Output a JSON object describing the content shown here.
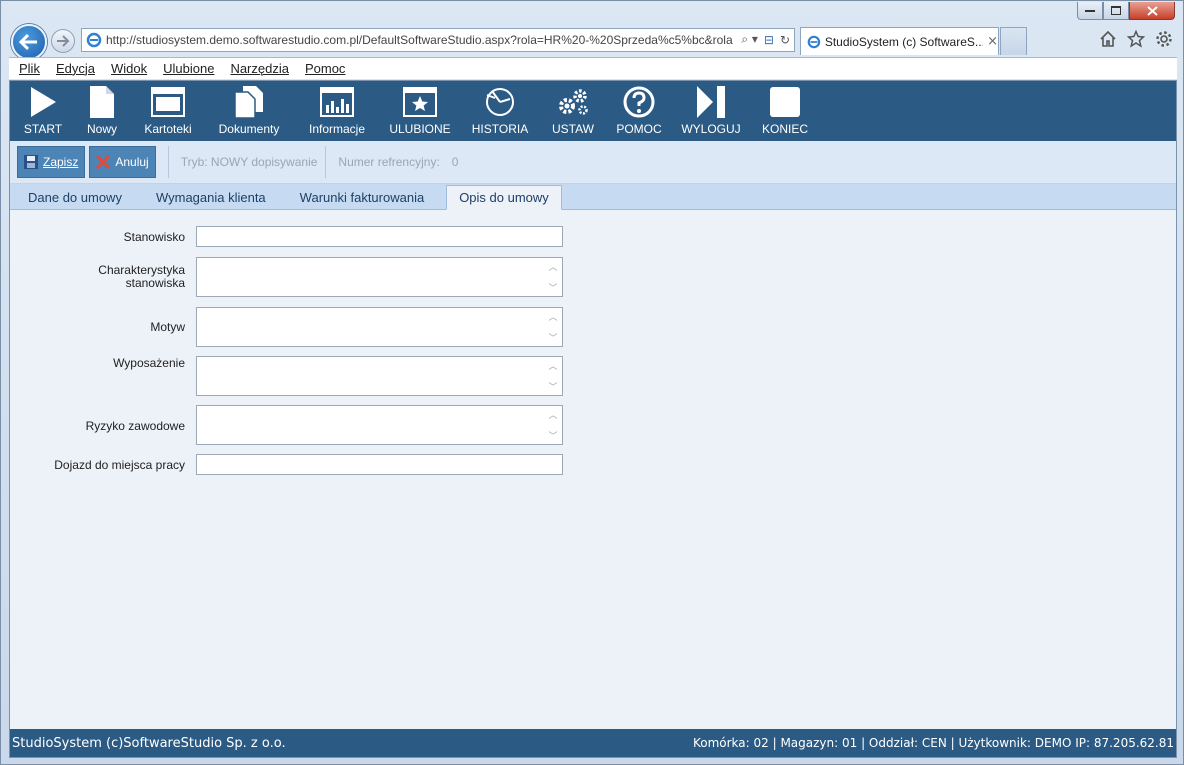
{
  "browser": {
    "url": "http://studiosystem.demo.softwarestudio.com.pl/DefaultSoftwareStudio.aspx?rola=HR%20-%20Sprzeda%c5%bc&rola",
    "tab_title": "StudioSystem (c) SoftwareS...",
    "tab_close": "×",
    "address_search": "⌕ ▾",
    "address_compat": "⊟",
    "address_refresh": "↻"
  },
  "menu": [
    "Plik",
    "Edycja",
    "Widok",
    "Ulubione",
    "Narzędzia",
    "Pomoc"
  ],
  "toolbar": [
    {
      "label": "START",
      "icon": "play-icon"
    },
    {
      "label": "Nowy",
      "icon": "new-document-icon"
    },
    {
      "label": "Kartoteki",
      "icon": "window-icon"
    },
    {
      "label": "Dokumenty",
      "icon": "documents-icon"
    },
    {
      "label": "Informacje",
      "icon": "chart-window-icon"
    },
    {
      "label": "ULUBIONE",
      "icon": "star-window-icon"
    },
    {
      "label": "HISTORIA",
      "icon": "history-icon"
    },
    {
      "label": "USTAW",
      "icon": "gears-icon"
    },
    {
      "label": "POMOC",
      "icon": "help-icon"
    },
    {
      "label": "WYLOGUJ",
      "icon": "logout-icon"
    },
    {
      "label": "KONIEC",
      "icon": "stop-icon"
    }
  ],
  "actions": {
    "save": "Zapisz",
    "cancel": "Anuluj",
    "mode": "Tryb: NOWY dopisywanie",
    "refnum": "Numer refrencyjny:",
    "refnum_value": "0"
  },
  "tabs": [
    "Dane do umowy",
    "Wymagania klienta",
    "Warunki fakturowania",
    "Opis do umowy"
  ],
  "active_tab": "Opis do umowy",
  "form": {
    "stanowisko": {
      "label": "Stanowisko",
      "value": ""
    },
    "charakterystyka": {
      "label1": "Charakterystyka",
      "label2": "stanowiska",
      "value": ""
    },
    "motyw": {
      "label": "Motyw",
      "value": ""
    },
    "wyposazenie": {
      "label": "Wyposażenie",
      "value": ""
    },
    "ryzyko": {
      "label": "Ryzyko zawodowe",
      "value": ""
    },
    "dojazd": {
      "label": "Dojazd do miejsca pracy",
      "value": ""
    }
  },
  "status": {
    "left": "StudioSystem (c)SoftwareStudio Sp. z o.o.",
    "right": "Komórka: 02 | Magazyn: 01 | Oddział: CEN | Użytkownik: DEMO IP: 87.205.62.81"
  }
}
